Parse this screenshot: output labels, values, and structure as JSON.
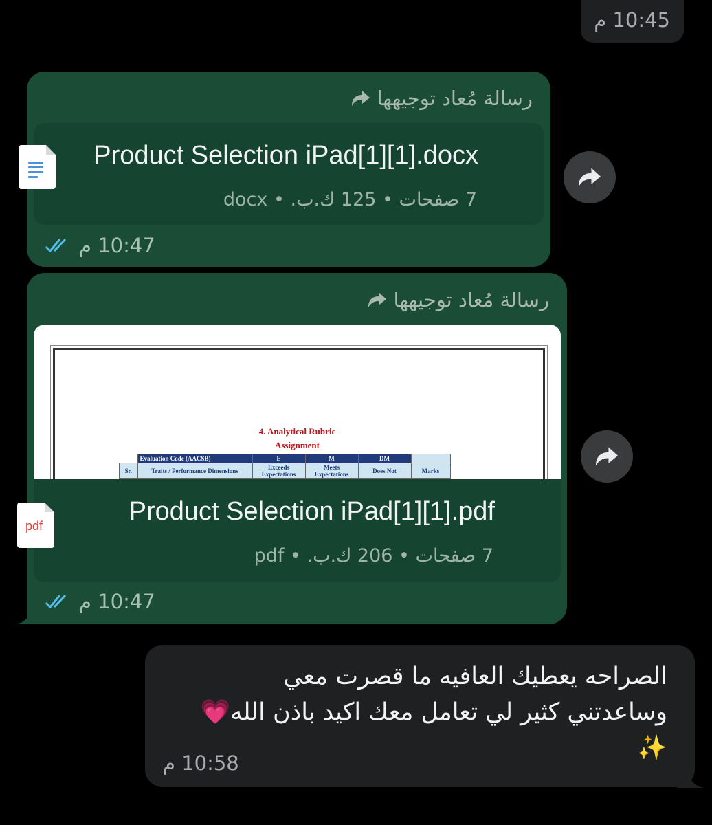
{
  "top_message": {
    "time": "10:45 م"
  },
  "messages": [
    {
      "forwarded_label": "رسالة مُعاد توجيهها",
      "file_name": "Product Selection  iPad[1][1].docx",
      "file_meta": "7 صفحات • 125 ك.ب. • docx",
      "time": "10:47 م",
      "icon": "docx-icon"
    },
    {
      "forwarded_label": "رسالة مُعاد توجيهها",
      "file_name": "Product Selection  iPad[1][1].pdf",
      "file_meta": "7 صفحات • 206 ك.ب. • pdf",
      "time": "10:47 م",
      "icon": "pdf-icon",
      "icon_text": "pdf",
      "preview": {
        "heading": "4.  Analytical Rubric",
        "subheading": "Assignment",
        "table_header": [
          "Evaluation Code (AACSB)",
          "E",
          "M",
          "DM"
        ],
        "table_sub": [
          "Sr.",
          "Traits / Performance Dimensions",
          "Exceeds Expectations",
          "Meets Expectations",
          "Does Not",
          "Marks"
        ]
      }
    }
  ],
  "reply": {
    "line1": "الصراحه يعطيك العافيه ما قصرت معي",
    "line2": "وساعدتني كثير لي تعامل معك اكيد باذن الله💗",
    "line3": "✨",
    "time": "10:58 م"
  },
  "colors": {
    "outgoing_bubble": "#1b4d36",
    "incoming_bubble": "#1f2022",
    "read_ticks": "#53bdeb",
    "background": "#000000"
  }
}
